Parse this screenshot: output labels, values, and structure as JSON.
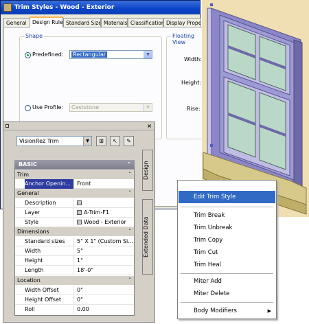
{
  "dialog": {
    "title": "Trim Styles - Wood - Exterior",
    "tabs": [
      "General",
      "Design Rules",
      "Standard Sizes",
      "Materials",
      "Classifications",
      "Display Properti"
    ],
    "active_tab": "Design Rules",
    "shape_group": "Shape",
    "floating_group": "Floating View",
    "predefined_label": "Predefined:",
    "predefined_value": "Rectangular",
    "use_profile_label": "Use Profile:",
    "profile_value": "Caststone",
    "width_label": "Width:",
    "height_label": "Height:",
    "rise_label": "Rise:"
  },
  "palette": {
    "selector": "VisionRez Trim",
    "design_tab": "Design",
    "extended_tab": "Extended Data",
    "basic_header": "BASIC",
    "categories": {
      "trim": "Trim",
      "general": "General",
      "dimensions": "Dimensions",
      "location": "Location"
    },
    "rows": {
      "anchor": {
        "k": "Anchor Openin...",
        "v": "Front"
      },
      "description": {
        "k": "Description",
        "v": ""
      },
      "layer": {
        "k": "Layer",
        "v": "A-Trim-F1"
      },
      "style": {
        "k": "Style",
        "v": "Wood - Exterior"
      },
      "standard_sizes": {
        "k": "Standard sizes",
        "v": "5\" X 1\" (Custom Si..."
      },
      "width": {
        "k": "Width",
        "v": "5\""
      },
      "height": {
        "k": "Height",
        "v": "1\""
      },
      "length": {
        "k": "Length",
        "v": "18'-0\""
      },
      "width_offset": {
        "k": "Width Offset",
        "v": "0\""
      },
      "height_offset": {
        "k": "Height Offset",
        "v": "0\""
      },
      "roll": {
        "k": "Roll",
        "v": "0.00"
      }
    }
  },
  "context_menu": {
    "items": [
      "Edit Trim Style",
      "Trim Break",
      "Trim Unbreak",
      "Trim Copy",
      "Trim Cut",
      "Trim Heal",
      "Miter Add",
      "Miter Delete",
      "Body Modifiers"
    ],
    "active": "Edit Trim Style"
  },
  "colors": {
    "title_bar": "#0a43c8",
    "menu_highlight": "#316ac5",
    "window_background": "#efdfb3",
    "glass": "#b9d8c8",
    "trim": "#d6c98a",
    "frame": "#8a86c8"
  }
}
